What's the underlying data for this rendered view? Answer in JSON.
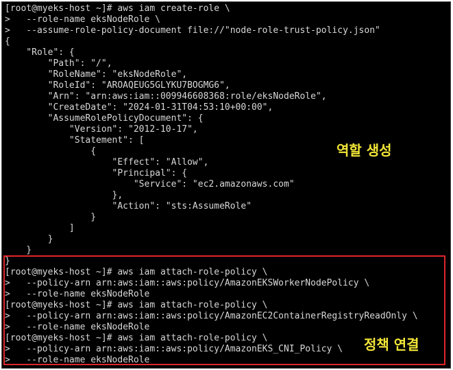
{
  "terminal": {
    "lines": [
      "[root@myeks-host ~]# aws iam create-role \\",
      ">   --role-name eksNodeRole \\",
      ">   --assume-role-policy-document file://\"node-role-trust-policy.json\"",
      "{",
      "    \"Role\": {",
      "        \"Path\": \"/\",",
      "        \"RoleName\": \"eksNodeRole\",",
      "        \"RoleId\": \"AROAQEUG5GLYKU7BOGMG6\",",
      "        \"Arn\": \"arn:aws:iam::009946608368:role/eksNodeRole\",",
      "        \"CreateDate\": \"2024-01-31T04:53:10+00:00\",",
      "        \"AssumeRolePolicyDocument\": {",
      "            \"Version\": \"2012-10-17\",",
      "            \"Statement\": [",
      "                {",
      "                    \"Effect\": \"Allow\",",
      "                    \"Principal\": {",
      "                        \"Service\": \"ec2.amazonaws.com\"",
      "                    },",
      "                    \"Action\": \"sts:AssumeRole\"",
      "                }",
      "            ]",
      "        }",
      "    }",
      "}",
      "[root@myeks-host ~]# aws iam attach-role-policy \\",
      ">   --policy-arn arn:aws:iam::aws:policy/AmazonEKSWorkerNodePolicy \\",
      ">   --role-name eksNodeRole",
      "[root@myeks-host ~]# aws iam attach-role-policy \\",
      ">   --policy-arn arn:aws:iam::aws:policy/AmazonEC2ContainerRegistryReadOnly \\",
      ">   --role-name eksNodeRole",
      "[root@myeks-host ~]# aws iam attach-role-policy \\",
      ">   --policy-arn arn:aws:iam::aws:policy/AmazonEKS_CNI_Policy \\",
      ">   --role-name eksNodeRole"
    ]
  },
  "annotations": {
    "create_role": "역할 생성",
    "attach_policy": "정책 연결",
    "text_color": "#f2e637",
    "box_color": "#e0262b"
  }
}
